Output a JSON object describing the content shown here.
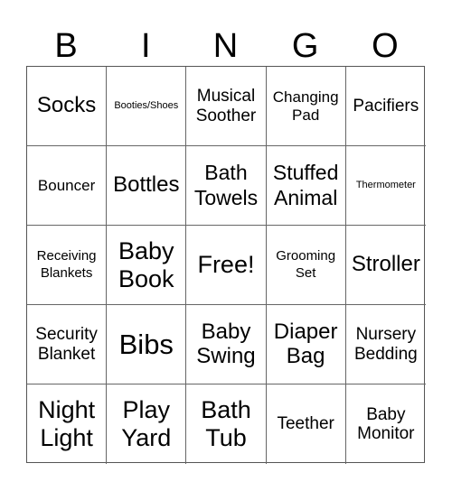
{
  "header": {
    "letters": [
      "B",
      "I",
      "N",
      "G",
      "O"
    ]
  },
  "grid": {
    "rows": [
      [
        "Socks",
        "Booties/Shoes",
        "Musical Soother",
        "Changing Pad",
        "Pacifiers"
      ],
      [
        "Bouncer",
        "Bottles",
        "Bath Towels",
        "Stuffed Animal",
        "Thermometer"
      ],
      [
        "Receiving Blankets",
        "Baby Book",
        "Free!",
        "Grooming Set",
        "Stroller"
      ],
      [
        "Security Blanket",
        "Bibs",
        "Baby Swing",
        "Diaper Bag",
        "Nursery Bedding"
      ],
      [
        "Night Light",
        "Play Yard",
        "Bath Tub",
        "Teether",
        "Baby Monitor"
      ]
    ]
  }
}
